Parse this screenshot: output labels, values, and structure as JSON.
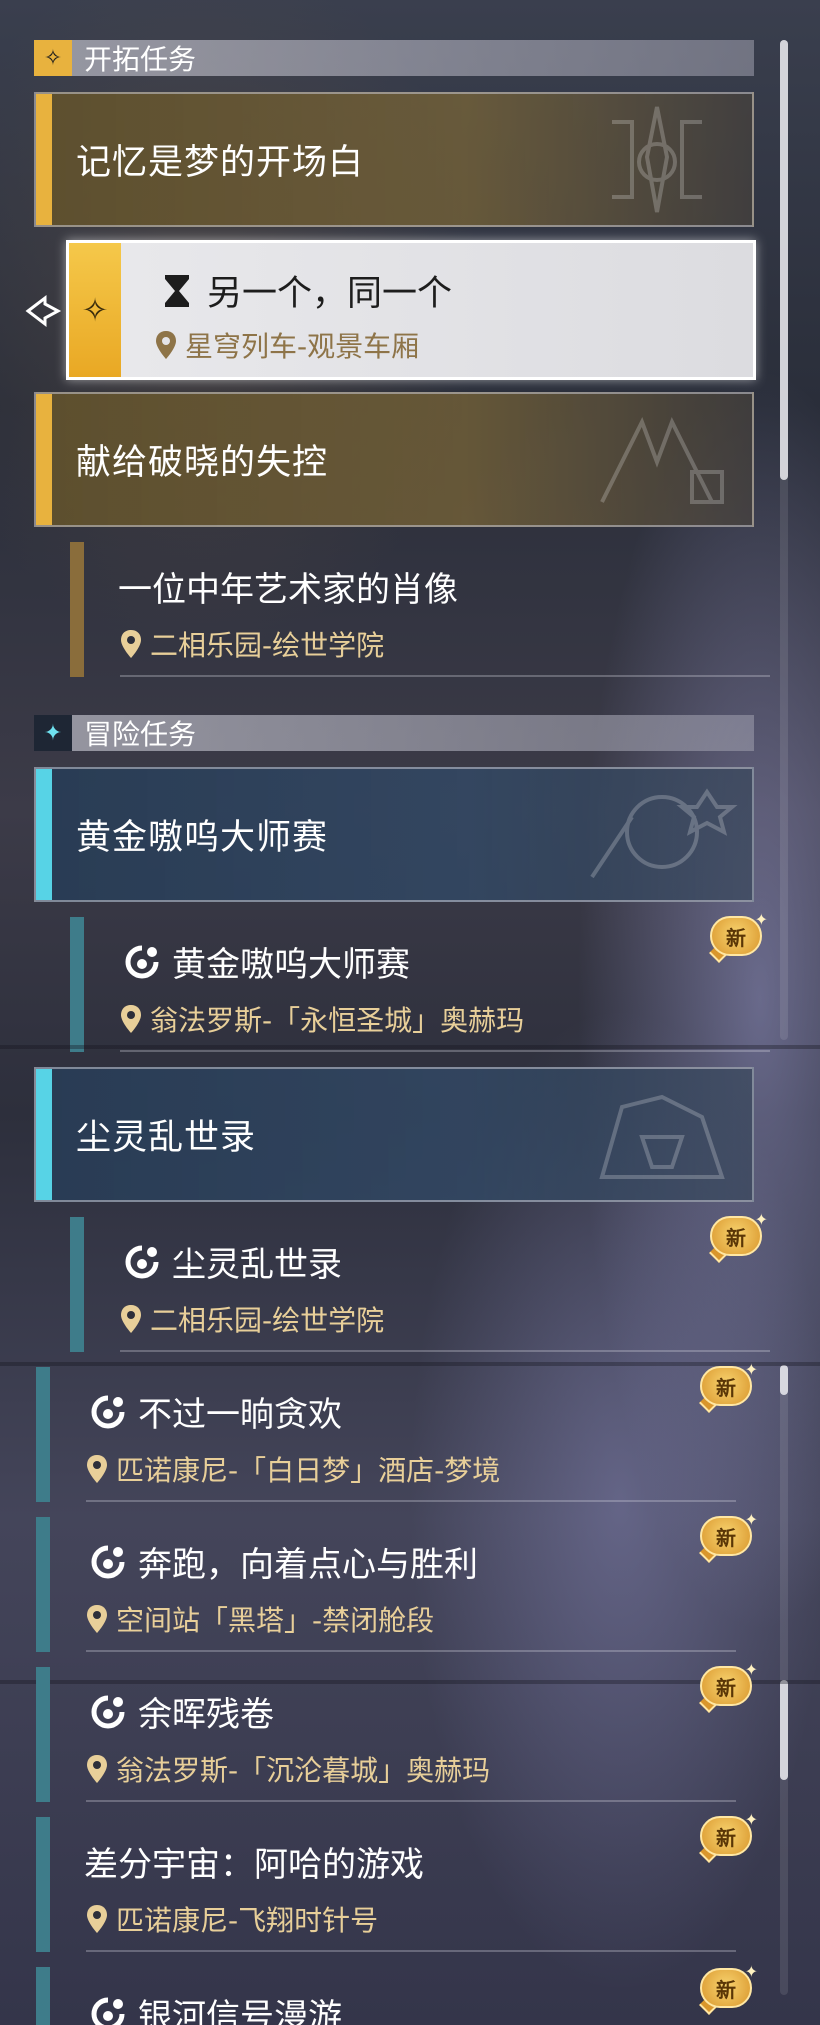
{
  "sections": {
    "trailblaze": {
      "title": "开拓任务"
    },
    "adventure": {
      "title": "冒险任务"
    }
  },
  "groups": [
    {
      "title": "记忆是梦的开场白"
    },
    {
      "title": "献给破晓的失控"
    },
    {
      "title": "黄金嗷呜大师赛"
    },
    {
      "title": "尘灵乱世录"
    }
  ],
  "selected_quest": {
    "title": "另一个，同一个",
    "location": "星穹列车-观景车厢"
  },
  "quests": [
    {
      "title": "一位中年艺术家的肖像",
      "location": "二相乐园-绘世学院"
    },
    {
      "title": "黄金嗷呜大师赛",
      "location": "翁法罗斯-「永恒圣城」奥赫玛",
      "badge": "新"
    },
    {
      "title": "尘灵乱世录",
      "location": "二相乐园-绘世学院",
      "badge": "新"
    },
    {
      "title": "不过一晌贪欢",
      "location": "匹诺康尼-「白日梦」酒店-梦境",
      "badge": "新"
    },
    {
      "title": "奔跑，向着点心与胜利",
      "location": "空间站「黑塔」-禁闭舱段",
      "badge": "新"
    },
    {
      "title": "余晖残卷",
      "location": "翁法罗斯-「沉沦暮城」奥赫玛",
      "badge": "新"
    },
    {
      "title": "差分宇宙：阿哈的游戏",
      "location": "匹诺康尼-飞翔时针号",
      "badge": "新"
    },
    {
      "title": "银河信号漫游",
      "badge": "新"
    }
  ],
  "colors": {
    "trailblaze_accent": "#e8b23e",
    "adventure_accent": "#57d3e6",
    "location_text": "#e8cf99",
    "new_badge": "#e9b04a"
  },
  "icons": {
    "trailblaze_section": "trailblaze-diamond-icon",
    "adventure_section": "adventure-star-icon",
    "selected_quest": "hourglass-icon",
    "adventure_quest": "adventure-swirl-icon",
    "location": "map-pin-icon",
    "cursor": "selection-arrow-icon"
  }
}
